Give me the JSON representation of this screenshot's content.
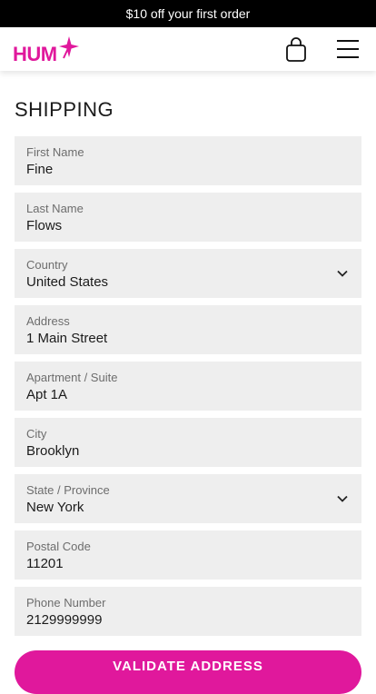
{
  "promo": {
    "text": "$10 off your first order"
  },
  "header": {
    "logo_text": "HUM",
    "icons": {
      "bag": "shopping-bag-icon",
      "menu": "hamburger-menu-icon",
      "logo_mark": "sparkle-icon"
    }
  },
  "colors": {
    "brand": "#e0189c",
    "field_bg": "#eeeeee",
    "promo_bg": "#000000"
  },
  "form": {
    "title": "SHIPPING",
    "fields": [
      {
        "label": "First Name",
        "value": "Fine"
      },
      {
        "label": "Last Name",
        "value": "Flows"
      },
      {
        "label": "Country",
        "value": "United States"
      },
      {
        "label": "Address",
        "value": "1 Main Street"
      },
      {
        "label": "Apartment / Suite",
        "value": "Apt 1A"
      },
      {
        "label": "City",
        "value": "Brooklyn"
      },
      {
        "label": "State / Province",
        "value": "New York"
      },
      {
        "label": "Postal Code",
        "value": "11201"
      },
      {
        "label": "Phone Number",
        "value": "2129999999"
      }
    ],
    "submit_label": "VALIDATE ADDRESS"
  }
}
